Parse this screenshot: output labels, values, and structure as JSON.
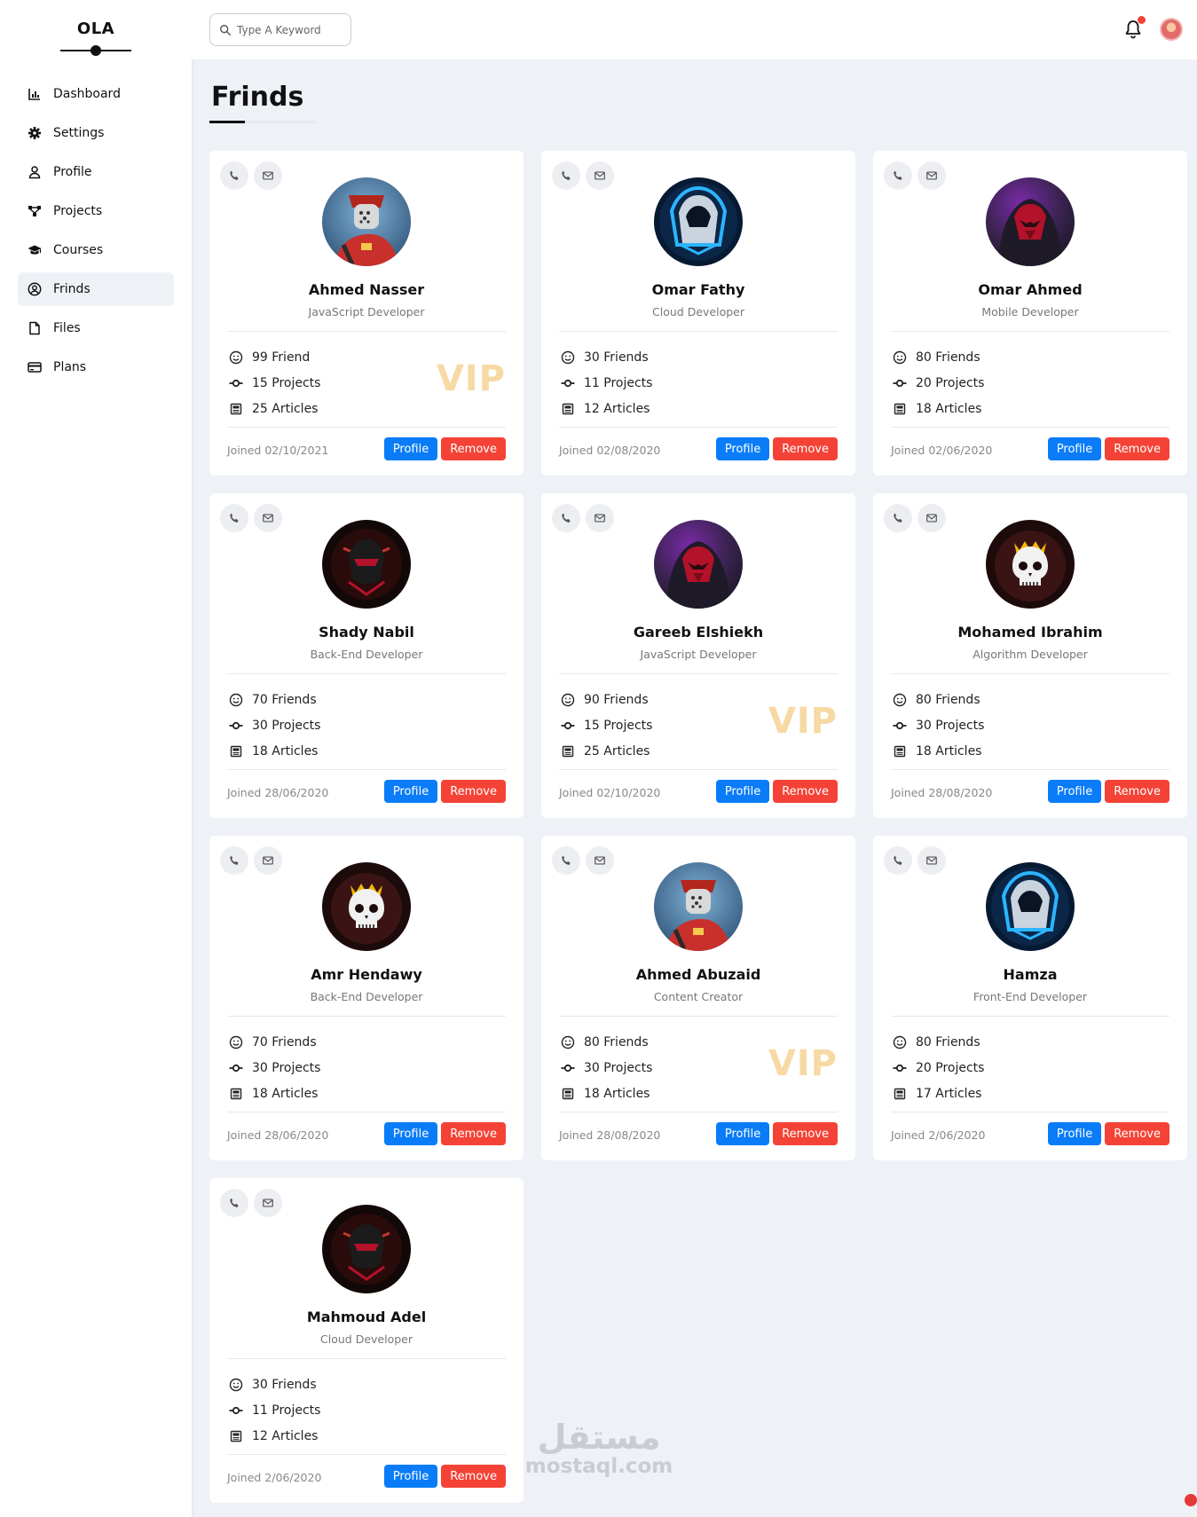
{
  "app": {
    "logo": "OLA"
  },
  "sidebar": {
    "items": [
      {
        "label": "Dashboard",
        "icon": "chart-icon",
        "active": false
      },
      {
        "label": "Settings",
        "icon": "gear-icon",
        "active": false
      },
      {
        "label": "Profile",
        "icon": "user-icon",
        "active": false
      },
      {
        "label": "Projects",
        "icon": "diagram-icon",
        "active": false
      },
      {
        "label": "Courses",
        "icon": "graduation-cap-icon",
        "active": false
      },
      {
        "label": "Frinds",
        "icon": "user-circle-icon",
        "active": true
      },
      {
        "label": "Files",
        "icon": "file-icon",
        "active": false
      },
      {
        "label": "Plans",
        "icon": "credit-card-icon",
        "active": false
      }
    ]
  },
  "header": {
    "search_placeholder": "Type A Keyword",
    "notification_dot_color": "#f44336"
  },
  "page": {
    "title": "Frinds"
  },
  "friends": [
    {
      "name": "Ahmed Nasser",
      "role": "JavaScript Developer",
      "friends": "99 Friend",
      "projects": "15 Projects",
      "articles": "25 Articles",
      "joined": "Joined 02/10/2021",
      "vip": "VIP",
      "avatar": "red-soldier"
    },
    {
      "name": "Omar Fathy",
      "role": "Cloud Developer",
      "friends": "30 Friends",
      "projects": "11 Projects",
      "articles": "12 Articles",
      "joined": "Joined 02/08/2020",
      "vip": "",
      "avatar": "blue-hood"
    },
    {
      "name": "Omar Ahmed",
      "role": "Mobile Developer",
      "friends": "80 Friends",
      "projects": "20 Projects",
      "articles": "18 Articles",
      "joined": "Joined 02/06/2020",
      "vip": "",
      "avatar": "red-mask"
    },
    {
      "name": "Shady Nabil",
      "role": "Back-End Developer",
      "friends": "70 Friends",
      "projects": "30 Projects",
      "articles": "18 Articles",
      "joined": "Joined 28/06/2020",
      "vip": "",
      "avatar": "dark-ninja"
    },
    {
      "name": "Gareeb Elshiekh",
      "role": "JavaScript Developer",
      "friends": "90 Friends",
      "projects": "15 Projects",
      "articles": "25 Articles",
      "joined": "Joined 02/10/2020",
      "vip": "VIP",
      "avatar": "red-mask"
    },
    {
      "name": "Mohamed Ibrahim",
      "role": "Algorithm Developer",
      "friends": "80 Friends",
      "projects": "30 Projects",
      "articles": "18 Articles",
      "joined": "Joined 28/08/2020",
      "vip": "",
      "avatar": "skull-crown"
    },
    {
      "name": "Amr Hendawy",
      "role": "Back-End Developer",
      "friends": "70 Friends",
      "projects": "30 Projects",
      "articles": "18 Articles",
      "joined": "Joined 28/06/2020",
      "vip": "",
      "avatar": "skull-crown"
    },
    {
      "name": "Ahmed Abuzaid",
      "role": "Content Creator",
      "friends": "80 Friends",
      "projects": "30 Projects",
      "articles": "18 Articles",
      "joined": "Joined 28/08/2020",
      "vip": "VIP",
      "avatar": "red-soldier"
    },
    {
      "name": "Hamza",
      "role": "Front-End Developer",
      "friends": "80 Friends",
      "projects": "20 Projects",
      "articles": "17 Articles",
      "joined": "Joined 2/06/2020",
      "vip": "",
      "avatar": "blue-hood"
    },
    {
      "name": "Mahmoud Adel",
      "role": "Cloud Developer",
      "friends": "30 Friends",
      "projects": "11 Projects",
      "articles": "12 Articles",
      "joined": "Joined 2/06/2020",
      "vip": "",
      "avatar": "dark-ninja"
    }
  ],
  "card_buttons": {
    "profile": "Profile",
    "remove": "Remove"
  },
  "colors": {
    "primary": "#0a7cf7",
    "danger": "#f44336",
    "vip": "#f7d9a4",
    "background": "#eef1f6"
  },
  "watermark": {
    "arabic": "مستقل",
    "latin": "mostaql.com"
  }
}
